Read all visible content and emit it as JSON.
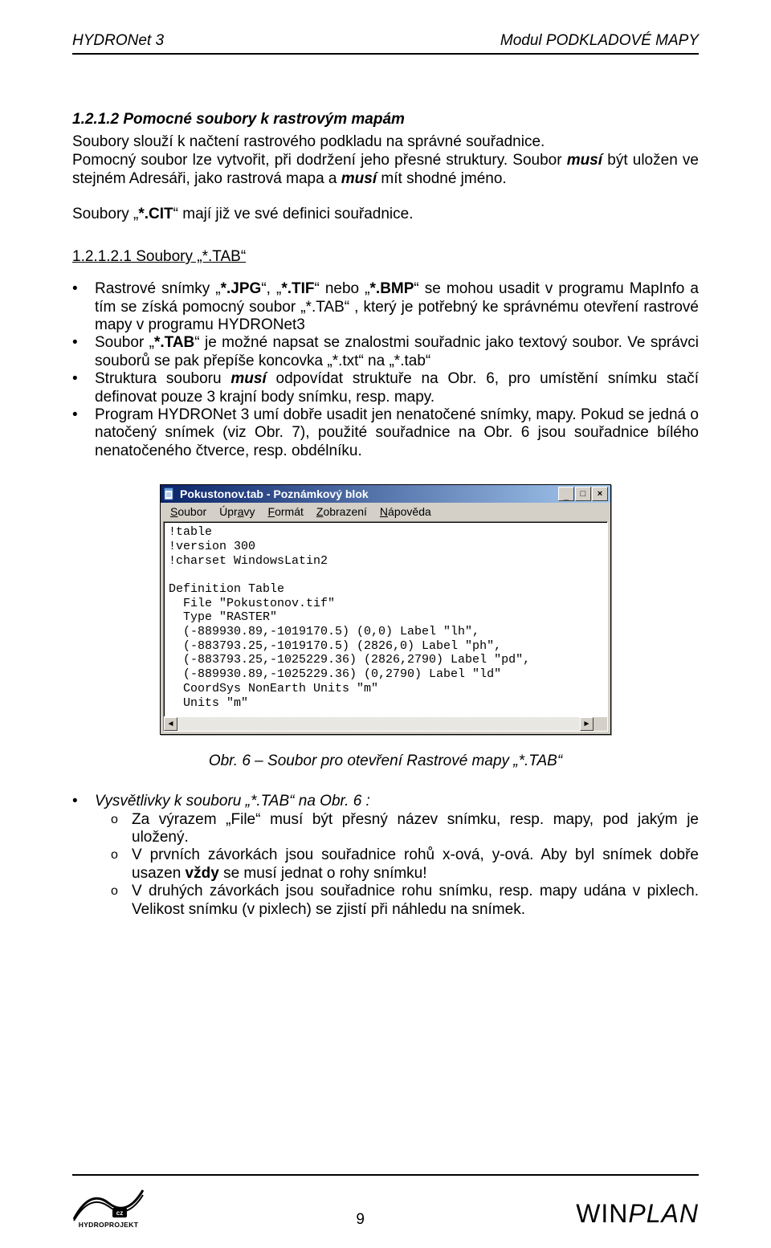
{
  "header": {
    "left": "HYDRONet 3",
    "right": "Modul  PODKLADOVÉ MAPY"
  },
  "section": {
    "number_title": "1.2.1.2   Pomocné soubory k rastrovým mapám",
    "para1_a": "Soubory slouží k načtení rastrového podkladu na správné souřadnice.",
    "para1_b_pre": "Pomocný soubor lze vytvořit, při dodržení jeho přesné struktury. Soubor ",
    "para1_b_musi": "musí",
    "para1_b_mid": " být uložen ve stejném Adresáři, jako rastrová mapa a ",
    "para1_b_musi2": "musí",
    "para1_b_post": " mít shodné jméno.",
    "para2_pre": "Soubory „",
    "para2_cit": "*.CIT",
    "para2_post": "“ mají již ve své definici souřadnice."
  },
  "subsection": {
    "title": "1.2.1.2.1   Soubory  „*.TAB“"
  },
  "bullets1": {
    "b1": "Rastrové snímky „*.JPG“, „*.TIF“ nebo „*.BMP“ se mohou usadit v programu MapInfo a tím se získá pomocný soubor „*.TAB“ , který je potřebný ke správnému otevření rastrové mapy v programu HYDRONet3",
    "b2": "Soubor „*.TAB“ je možné napsat se znalostmi souřadnic jako textový soubor. Ve správci souborů se pak přepíše koncovka  „*.txt“ na „*.tab“",
    "b3_pre": "Struktura souboru ",
    "b3_musi": "musí",
    "b3_post": " odpovídat struktuře na Obr. 6, pro umístění snímku stačí definovat pouze 3 krajní body snímku, resp. mapy.",
    "b4": "Program HYDRONet 3 umí dobře usadit jen nenatočené snímky, mapy. Pokud se jedná o natočený snímek (viz Obr. 7), použité souřadnice na Obr. 6 jsou souřadnice bílého nenatočeného čtverce, resp. obdélníku."
  },
  "notepad": {
    "title": "Pokustonov.tab - Poznámkový blok",
    "menu": {
      "soubor": "Soubor",
      "upravy": "Úpravy",
      "format": "Formát",
      "zobrazeni": "Zobrazení",
      "napoveda": "Nápověda"
    },
    "winbtns": {
      "min": "_",
      "max": "□",
      "close": "×"
    },
    "content": "!table\n!version 300\n!charset WindowsLatin2\n\nDefinition Table\n  File \"Pokustonov.tif\"\n  Type \"RASTER\"\n  (-889930.89,-1019170.5) (0,0) Label \"lh\",\n  (-883793.25,-1019170.5) (2826,0) Label \"ph\",\n  (-883793.25,-1025229.36) (2826,2790) Label \"pd\",\n  (-889930.89,-1025229.36) (0,2790) Label \"ld\"\n  CoordSys NonEarth Units \"m\"\n  Units \"m\""
  },
  "caption": "Obr. 6 – Soubor pro otevření Rastrové mapy „*.TAB“",
  "bullets2": {
    "heading": "Vysvětlivky k souboru „*.TAB“ na Obr. 6 :",
    "s1": "Za výrazem „File“ musí být přesný název snímku, resp. mapy, pod jakým je uložený.",
    "s2_pre": "V prvních závorkách jsou souřadnice rohů x-ová, y-ová. Aby byl snímek dobře usazen ",
    "s2_bold": "vždy",
    "s2_post": " se musí jednat o rohy snímku!",
    "s3": "V druhých závorkách jsou souřadnice rohu snímku, resp. mapy udána v pixlech. Velikost snímku (v pixlech) se zjistí při náhledu na snímek."
  },
  "footer": {
    "page": "9",
    "brand_win": "WIN",
    "brand_plan": "PLAN",
    "logo_text_top": "HYDROPROJEKT",
    "logo_badge": "cz"
  }
}
